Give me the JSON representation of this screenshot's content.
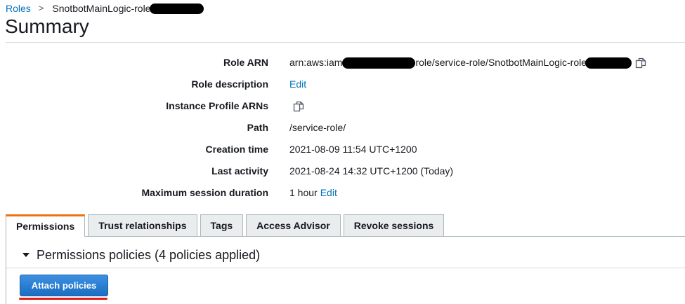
{
  "breadcrumb": {
    "root": "Roles",
    "separator": ">",
    "current": "SnotbotMainLogic-role"
  },
  "page_title": "Summary",
  "summary": {
    "role_arn": {
      "label": "Role ARN",
      "value_prefix": "arn:aws:iam",
      "value_suffix": "role/service-role/SnotbotMainLogic-role"
    },
    "role_description": {
      "label": "Role description",
      "link": "Edit"
    },
    "instance_profile_arns": {
      "label": "Instance Profile ARNs"
    },
    "path": {
      "label": "Path",
      "value": "/service-role/"
    },
    "creation_time": {
      "label": "Creation time",
      "value": "2021-08-09 11:54 UTC+1200"
    },
    "last_activity": {
      "label": "Last activity",
      "value": "2021-08-24 14:32 UTC+1200 (Today)"
    },
    "max_session_duration": {
      "label": "Maximum session duration",
      "value": "1 hour",
      "link": "Edit"
    }
  },
  "tabs": [
    {
      "label": "Permissions",
      "active": true
    },
    {
      "label": "Trust relationships",
      "active": false
    },
    {
      "label": "Tags",
      "active": false
    },
    {
      "label": "Access Advisor",
      "active": false
    },
    {
      "label": "Revoke sessions",
      "active": false
    }
  ],
  "permissions": {
    "section_title": "Permissions policies (4 policies applied)",
    "attach_button": "Attach policies"
  },
  "icons": {
    "copy": "copy-icon",
    "caret": "caret-down-icon"
  },
  "colors": {
    "link": "#0073bb",
    "active_tab_accent": "#ec7211",
    "primary_button": "#1a6fc4",
    "highlight_underline": "#e02020"
  }
}
